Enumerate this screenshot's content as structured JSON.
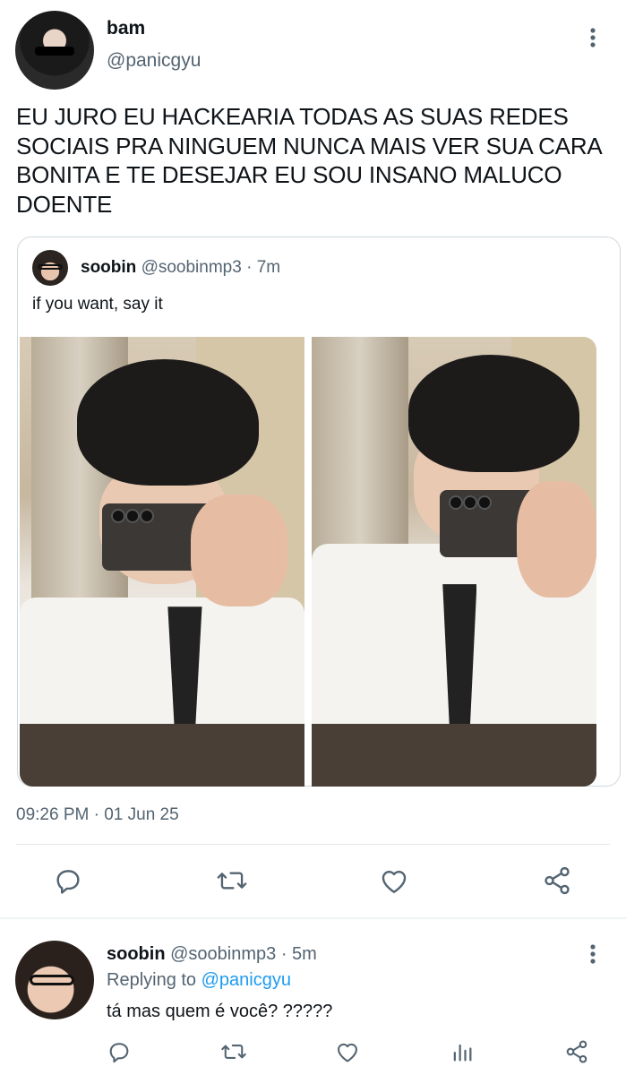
{
  "tweet": {
    "author_name": "bam",
    "author_handle": "@panicgyu",
    "text": "EU JURO EU HACKEARIA TODAS AS SUAS REDES SOCIAIS PRA NINGUEM NUNCA MAIS VER SUA CARA BONITA E TE DESEJAR EU SOU INSANO MALUCO DOENTE",
    "timestamp": "09:26 PM · 01 Jun 25",
    "more_icon": "more-vertical-icon"
  },
  "quote": {
    "author_name": "soobin",
    "author_handle": "@soobinmp3",
    "time": "· 7m",
    "text": "if you want, say it"
  },
  "actions": {
    "reply_icon": "reply-icon",
    "retweet_icon": "retweet-icon",
    "like_icon": "heart-icon",
    "share_icon": "share-icon"
  },
  "reply": {
    "author_name": "soobin",
    "author_handle": "@soobinmp3",
    "time": "· 5m",
    "replying_prefix": "Replying to",
    "replying_to": "@panicgyu",
    "text": "tá mas quem é você? ?????",
    "icons": [
      "reply-icon",
      "retweet-icon",
      "heart-icon",
      "analytics-icon",
      "share-icon"
    ]
  }
}
